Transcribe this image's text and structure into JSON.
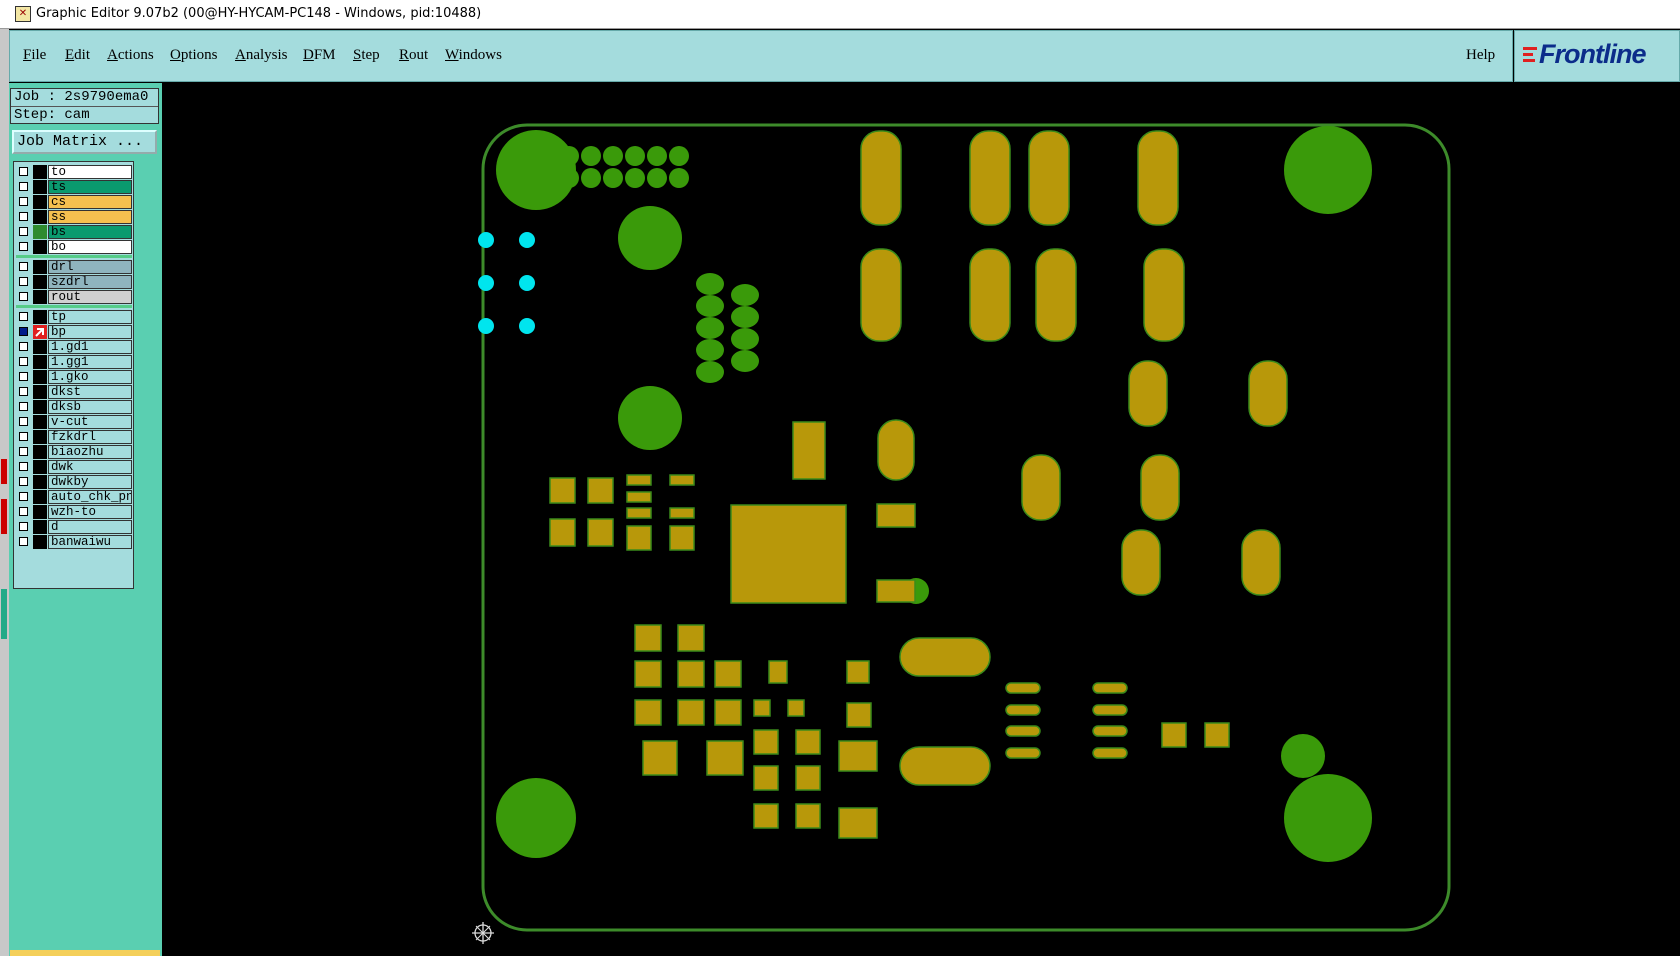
{
  "window": {
    "title": "Graphic Editor 9.07b2 (00@HY-HYCAM-PC148 - Windows, pid:10488)"
  },
  "menu": {
    "items": [
      {
        "key": "F",
        "rest": "ile"
      },
      {
        "key": "E",
        "rest": "dit"
      },
      {
        "key": "A",
        "rest": "ctions"
      },
      {
        "key": "O",
        "rest": "ptions"
      },
      {
        "key": "A",
        "rest": "nalysis"
      },
      {
        "key": "D",
        "rest": "FM"
      },
      {
        "key": "S",
        "rest": "tep"
      },
      {
        "key": "R",
        "rest": "out"
      },
      {
        "key": "W",
        "rest": "indows"
      }
    ],
    "help": "Help",
    "logo": "Frontline"
  },
  "job": {
    "job_line": "Job : 2s9790ema0",
    "step_line": "Step: cam",
    "matrix_button": "Job Matrix ..."
  },
  "layers": [
    {
      "name": "to",
      "color": "#ffffff",
      "checked": false,
      "swatch": "#000"
    },
    {
      "name": "ts",
      "color": "#0a9a6e",
      "checked": false,
      "swatch": "#000"
    },
    {
      "name": "cs",
      "color": "#f5c04f",
      "checked": false,
      "swatch": "#000"
    },
    {
      "name": "ss",
      "color": "#f5c04f",
      "checked": false,
      "swatch": "#000"
    },
    {
      "name": "bs",
      "color": "#0a9a6e",
      "checked": false,
      "swatch": "#2e8b2e"
    },
    {
      "name": "bo",
      "color": "#ffffff",
      "checked": false,
      "swatch": "#000"
    },
    {
      "name": "drl",
      "color": "#8fb4be",
      "checked": false,
      "swatch": "#000",
      "gap": true
    },
    {
      "name": "szdrl",
      "color": "#8fb4be",
      "checked": false,
      "swatch": "#000"
    },
    {
      "name": "rout",
      "color": "#d0d0d0",
      "checked": false,
      "swatch": "#000"
    },
    {
      "name": "tp",
      "color": "#a4dcdd",
      "checked": false,
      "swatch": "#000",
      "gap": true
    },
    {
      "name": "bp",
      "color": "#a4dcdd",
      "checked": true,
      "swatch": "#e02020",
      "active": true
    },
    {
      "name": "1.gd1",
      "color": "#a4dcdd",
      "checked": false,
      "swatch": "#000"
    },
    {
      "name": "1.gg1",
      "color": "#a4dcdd",
      "checked": false,
      "swatch": "#000"
    },
    {
      "name": "1.gko",
      "color": "#a4dcdd",
      "checked": false,
      "swatch": "#000"
    },
    {
      "name": "dkst",
      "color": "#a4dcdd",
      "checked": false,
      "swatch": "#000"
    },
    {
      "name": "dksb",
      "color": "#a4dcdd",
      "checked": false,
      "swatch": "#000"
    },
    {
      "name": "v-cut",
      "color": "#a4dcdd",
      "checked": false,
      "swatch": "#000"
    },
    {
      "name": "fzkdrl",
      "color": "#a4dcdd",
      "checked": false,
      "swatch": "#000"
    },
    {
      "name": "biaozhu",
      "color": "#a4dcdd",
      "checked": false,
      "swatch": "#000"
    },
    {
      "name": "dwk",
      "color": "#a4dcdd",
      "checked": false,
      "swatch": "#000"
    },
    {
      "name": "dwkby",
      "color": "#a4dcdd",
      "checked": false,
      "swatch": "#000"
    },
    {
      "name": "auto_chk_pn.",
      "color": "#a4dcdd",
      "checked": false,
      "swatch": "#000"
    },
    {
      "name": "wzh-to",
      "color": "#a4dcdd",
      "checked": false,
      "swatch": "#000"
    },
    {
      "name": "d",
      "color": "#a4dcdd",
      "checked": false,
      "swatch": "#000"
    },
    {
      "name": "banwaiwu",
      "color": "#a4dcdd",
      "checked": false,
      "swatch": "#000"
    }
  ],
  "colors": {
    "pad_gold": "#b8980a",
    "pad_edge": "#3a8a1a",
    "hole_green": "#3a9a0a",
    "via_cyan": "#00e5ee",
    "outline_green": "#3d8b2a"
  }
}
